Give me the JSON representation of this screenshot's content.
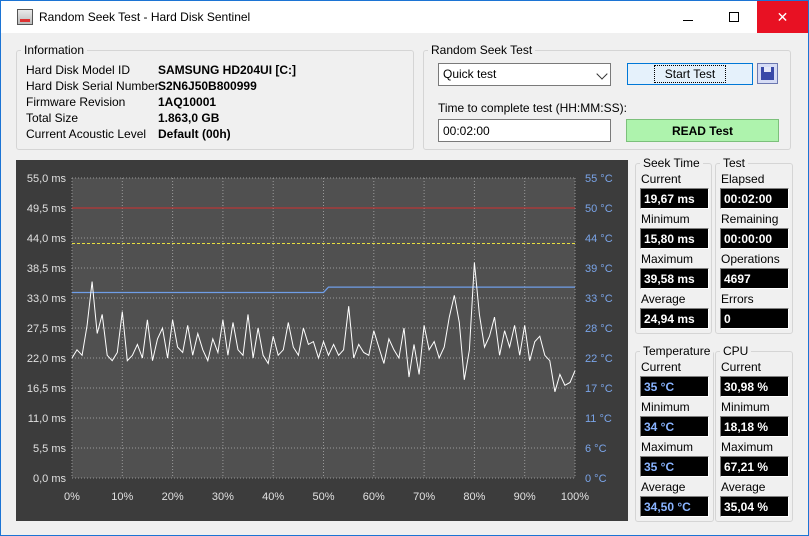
{
  "window": {
    "title": "Random Seek Test - Hard Disk Sentinel",
    "minimize_icon": "minimize-icon",
    "maximize_icon": "maximize-icon",
    "close_icon": "close-icon",
    "close_glyph": "✕"
  },
  "info": {
    "legend": "Information",
    "rows": [
      {
        "label": "Hard Disk Model ID",
        "value": "SAMSUNG HD204UI [C:]"
      },
      {
        "label": "Hard Disk Serial Number",
        "value": "S2N6J50B800999"
      },
      {
        "label": "Firmware Revision",
        "value": "1AQ10001"
      },
      {
        "label": "Total Size",
        "value": "1.863,0 GB"
      },
      {
        "label": "Current Acoustic Level",
        "value": "Default (00h)"
      }
    ]
  },
  "seek_test": {
    "legend": "Random Seek Test",
    "mode_selected": "Quick test",
    "start_label": "Start Test",
    "time_label": "Time to complete test (HH:MM:SS):",
    "time_value": "00:02:00",
    "read_label": "READ Test"
  },
  "stats": {
    "seek_legend": "Seek Time",
    "test_legend": "Test",
    "seek": [
      {
        "label": "Current",
        "value": "19,67 ms"
      },
      {
        "label": "Minimum",
        "value": "15,80 ms"
      },
      {
        "label": "Maximum",
        "value": "39,58 ms"
      },
      {
        "label": "Average",
        "value": "24,94 ms"
      }
    ],
    "test": [
      {
        "label": "Elapsed",
        "value": "00:02:00"
      },
      {
        "label": "Remaining",
        "value": "00:00:00"
      },
      {
        "label": "Operations",
        "value": "4697"
      },
      {
        "label": "Errors",
        "value": "0"
      }
    ],
    "temp_legend": "Temperature",
    "cpu_legend": "CPU",
    "temperature": [
      {
        "label": "Current",
        "value": "35 °C"
      },
      {
        "label": "Minimum",
        "value": "34 °C"
      },
      {
        "label": "Maximum",
        "value": "35 °C"
      },
      {
        "label": "Average",
        "value": "34,50 °C"
      }
    ],
    "cpu": [
      {
        "label": "Current",
        "value": "30,98 %"
      },
      {
        "label": "Minimum",
        "value": "18,18 %"
      },
      {
        "label": "Maximum",
        "value": "67,21 %"
      },
      {
        "label": "Average",
        "value": "35,04 %"
      }
    ]
  },
  "chart_data": {
    "type": "line",
    "y_left_ticks": [
      "55,0 ms",
      "49,5 ms",
      "44,0 ms",
      "38,5 ms",
      "33,0 ms",
      "27,5 ms",
      "22,0 ms",
      "16,5 ms",
      "11,0 ms",
      "5,5 ms",
      "0,0 ms"
    ],
    "y_right_ticks": [
      "55 °C",
      "50 °C",
      "44 °C",
      "39 °C",
      "33 °C",
      "28 °C",
      "22 °C",
      "17 °C",
      "11 °C",
      "6 °C",
      "0 °C"
    ],
    "x_ticks": [
      "0%",
      "10%",
      "20%",
      "30%",
      "40%",
      "50%",
      "60%",
      "70%",
      "80%",
      "90%",
      "100%"
    ],
    "ylim_ms": [
      0,
      55
    ],
    "ylim_c": [
      0,
      55
    ],
    "grid": true,
    "background_color": "#3c3c3c",
    "seek_color": "#ffffff",
    "temp_color": "#6f9ee8",
    "max_line_color": "#d03030",
    "avg_line_color": "#e8e040",
    "threshold_max_ms": 49.5,
    "threshold_avg_ms": 43.0,
    "temperature_series": {
      "x": [
        0,
        50,
        51,
        100
      ],
      "values": [
        34,
        34,
        35,
        35
      ]
    },
    "seek_series": {
      "x": [
        0,
        1,
        2,
        3,
        4,
        5,
        6,
        7,
        8,
        9,
        10,
        11,
        12,
        13,
        14,
        15,
        16,
        17,
        18,
        19,
        20,
        21,
        22,
        23,
        24,
        25,
        26,
        27,
        28,
        29,
        30,
        31,
        32,
        33,
        34,
        35,
        36,
        37,
        38,
        39,
        40,
        41,
        42,
        43,
        44,
        45,
        46,
        47,
        48,
        49,
        50,
        51,
        52,
        53,
        54,
        55,
        56,
        57,
        58,
        59,
        60,
        61,
        62,
        63,
        64,
        65,
        66,
        67,
        68,
        69,
        70,
        71,
        72,
        73,
        74,
        75,
        76,
        77,
        78,
        79,
        80,
        81,
        82,
        83,
        84,
        85,
        86,
        87,
        88,
        89,
        90,
        91,
        92,
        93,
        94,
        95,
        96,
        97,
        98,
        99,
        100
      ],
      "values": [
        22.0,
        23.5,
        22.5,
        28.0,
        36.0,
        26.5,
        30.0,
        22.5,
        21.5,
        23.0,
        30.5,
        21.5,
        22.5,
        24.5,
        22.0,
        29.0,
        21.5,
        25.5,
        27.5,
        22.0,
        29.0,
        24.0,
        23.0,
        28.0,
        22.5,
        26.5,
        23.5,
        21.5,
        25.5,
        23.0,
        29.0,
        22.5,
        28.5,
        23.5,
        22.5,
        30.0,
        22.0,
        27.5,
        22.5,
        21.0,
        26.0,
        22.5,
        23.5,
        28.5,
        24.0,
        22.5,
        27.5,
        24.5,
        25.0,
        22.0,
        25.0,
        22.5,
        24.5,
        22.5,
        23.5,
        31.5,
        22.0,
        24.5,
        23.0,
        22.5,
        27.0,
        24.0,
        21.0,
        25.5,
        23.5,
        22.0,
        27.5,
        18.5,
        24.5,
        19.0,
        28.0,
        23.5,
        25.0,
        22.0,
        24.0,
        29.5,
        33.5,
        28.5,
        18.0,
        23.5,
        39.5,
        30.0,
        24.0,
        26.0,
        29.5,
        22.5,
        27.0,
        24.0,
        28.0,
        22.5,
        28.0,
        21.5,
        25.0,
        26.0,
        22.5,
        21.5,
        15.8,
        19.0,
        17.0,
        17.5,
        19.67
      ]
    }
  }
}
